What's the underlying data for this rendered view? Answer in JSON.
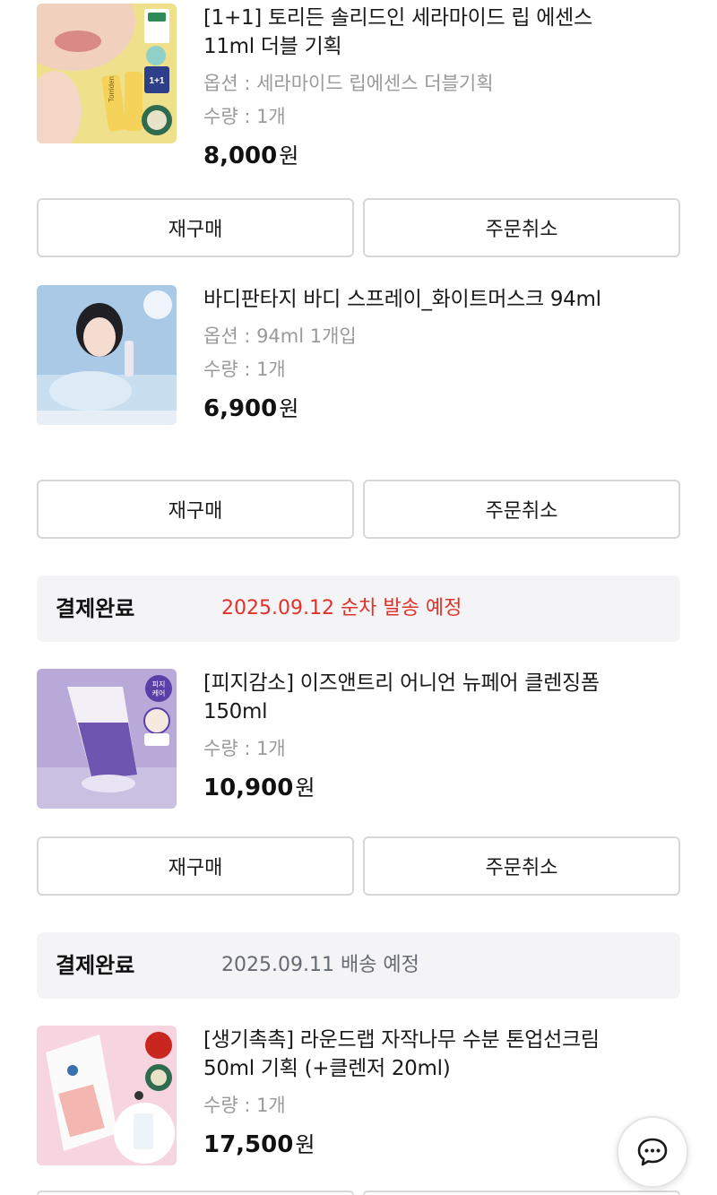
{
  "orders": [
    {
      "name": "[1+1] 토리든 솔리드인 세라마이드 립 에센스 11ml 더블 기획",
      "option": "옵션 : 세라마이드 립에센스 더블기획",
      "quantity": "수량 : 1개",
      "price": "8,000",
      "currency": "원",
      "image": "lip-essence-product-photo"
    },
    {
      "name": "바디판타지 바디 스프레이_화이트머스크 94ml",
      "option": "옵션 : 94ml 1개입",
      "quantity": "수량 : 1개",
      "price": "6,900",
      "currency": "원",
      "image": "body-spray-model-photo"
    },
    {
      "name": "[피지감소] 이즈앤트리 어니언 뉴페어 클렌징폼 150ml",
      "quantity": "수량 : 1개",
      "price": "10,900",
      "currency": "원",
      "image": "cleansing-foam-product-photo"
    },
    {
      "name": "[생기촉촉] 라운드랩 자작나무 수분 톤업선크림 50ml 기획 (+클렌저 20ml)",
      "quantity": "수량 : 1개",
      "price": "17,500",
      "currency": "원",
      "image": "sun-cream-product-photo"
    }
  ],
  "buttons": {
    "reorder": "재구매",
    "cancel": "주문취소"
  },
  "statuses": [
    {
      "label": "결제완료",
      "date": "2025.09.12 순차 발송 예정",
      "color": "#e0312a"
    },
    {
      "label": "결제완료",
      "date": "2025.09.11 배송 예정",
      "color": "#666a73"
    }
  ],
  "thumb_badges": {
    "lip_one_plus_one": "1+1",
    "lip_brand": "Torriden",
    "foam_badge": "피지\n케어"
  },
  "chat_icon": "chat-bubble-icon"
}
